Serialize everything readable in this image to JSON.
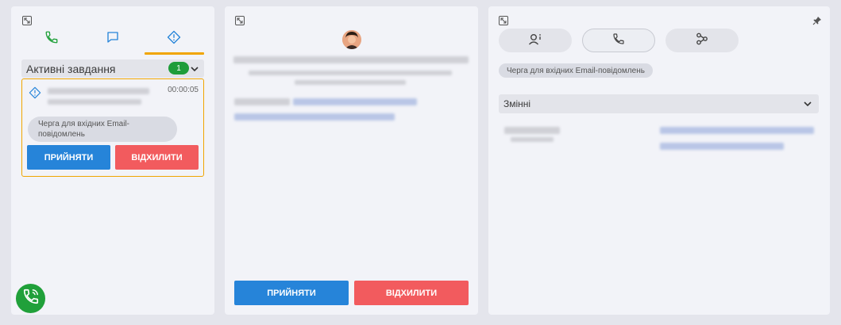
{
  "left_panel": {
    "tabs": [
      {
        "name": "calls",
        "icon": "phone-icon"
      },
      {
        "name": "chats",
        "icon": "chat-icon"
      },
      {
        "name": "tasks",
        "icon": "alert-diamond-icon",
        "active": true
      }
    ],
    "section_title": "Активні завдання",
    "task_count": "1",
    "task": {
      "timer": "00:00:05",
      "queue": "Черга для вхідних Email-повідомлень"
    },
    "accept_label": "ПРИЙНЯТИ",
    "reject_label": "ВІДХИЛИТИ"
  },
  "middle_panel": {
    "accept_label": "ПРИЙНЯТИ",
    "reject_label": "ВІДХИЛИТИ"
  },
  "right_panel": {
    "queue_tag": "Черга для вхідних Email-повідомлень",
    "variables_title": "Змінні"
  },
  "colors": {
    "accent_orange": "#f0a500",
    "accept_blue": "#2684d9",
    "reject_red": "#f25b5e",
    "call_green": "#20a03a"
  }
}
